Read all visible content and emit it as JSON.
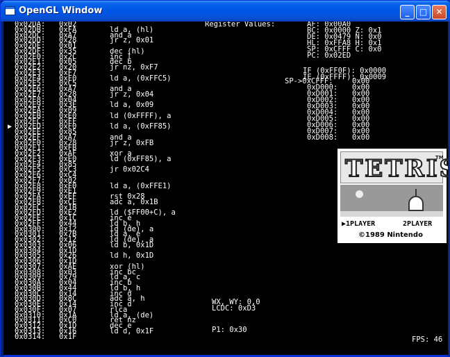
{
  "window": {
    "title": "OpenGL Window",
    "min": "_",
    "max": "□",
    "close": "✕"
  },
  "disasm": [
    {
      "addr": "0x02DA:",
      "byte": "0x02",
      "instr": ""
    },
    {
      "addr": "0x02DB:",
      "byte": "0xFA",
      "instr": "ld a, (hl)"
    },
    {
      "addr": "0x02DC:",
      "byte": "0xA7",
      "instr": "and a"
    },
    {
      "addr": "0x02DD:",
      "byte": "0x28",
      "instr": "jr z, 0x01"
    },
    {
      "addr": "0x02DE:",
      "byte": "0x01",
      "instr": ""
    },
    {
      "addr": "0x02DF:",
      "byte": "0x35",
      "instr": "dec (hl)"
    },
    {
      "addr": "0x02E0:",
      "byte": "0x2C",
      "instr": "inc l"
    },
    {
      "addr": "0x02E1:",
      "byte": "0x05",
      "instr": "dec b"
    },
    {
      "addr": "0x02E2:",
      "byte": "0x20",
      "instr": "jr nz, 0xF7"
    },
    {
      "addr": "0x02E3:",
      "byte": "0xF7",
      "instr": ""
    },
    {
      "addr": "0x02E4:",
      "byte": "0xF0",
      "instr": "ld a, (0xFFC5)"
    },
    {
      "addr": "0x02E5:",
      "byte": "0xC5",
      "instr": ""
    },
    {
      "addr": "0x02E6:",
      "byte": "0xA7",
      "instr": "and a"
    },
    {
      "addr": "0x02E7:",
      "byte": "0x28",
      "instr": "jr z, 0x04"
    },
    {
      "addr": "0x02E8:",
      "byte": "0x04",
      "instr": ""
    },
    {
      "addr": "0x02E9:",
      "byte": "0x3E",
      "instr": "ld a, 0x09"
    },
    {
      "addr": "0x02EA:",
      "byte": "0x09",
      "instr": ""
    },
    {
      "addr": "0x02EB:",
      "byte": "0xE0",
      "instr": "ld (0xFFFF), a"
    },
    {
      "addr": "0x02EC:",
      "byte": "0xFF",
      "instr": ""
    },
    {
      "addr": "0x02ED:",
      "byte": "0xF0",
      "instr": "ld a, (0xFF85)"
    },
    {
      "addr": "0x02EE:",
      "byte": "0x85",
      "instr": ""
    },
    {
      "addr": "0x02EF:",
      "byte": "0xA7",
      "instr": "and a"
    },
    {
      "addr": "0x02F0:",
      "byte": "0x28",
      "instr": "jr z, 0xFB"
    },
    {
      "addr": "0x02F1:",
      "byte": "0xFB",
      "instr": ""
    },
    {
      "addr": "0x02F2:",
      "byte": "0xAF",
      "instr": "xor a"
    },
    {
      "addr": "0x02F3:",
      "byte": "0xE0",
      "instr": "ld (0xFF85), a"
    },
    {
      "addr": "0x02F4:",
      "byte": "0x85",
      "instr": ""
    },
    {
      "addr": "0x02F5:",
      "byte": "0xC3",
      "instr": "jr 0x02C4"
    },
    {
      "addr": "0x02F6:",
      "byte": "0xC4",
      "instr": ""
    },
    {
      "addr": "0x02F7:",
      "byte": "0x02",
      "instr": ""
    },
    {
      "addr": "0x02F8:",
      "byte": "0xF0",
      "instr": "ld a, (0xFFE1)"
    },
    {
      "addr": "0x02F9:",
      "byte": "0xE1",
      "instr": ""
    },
    {
      "addr": "0x02FA:",
      "byte": "0xEF",
      "instr": "rst 0x28"
    },
    {
      "addr": "0x02FB:",
      "byte": "0xCE",
      "instr": "adc a, 0x1B"
    },
    {
      "addr": "0x02FC:",
      "byte": "0x1B",
      "instr": ""
    },
    {
      "addr": "0x02FD:",
      "byte": "0xE2",
      "instr": "ld ($FF00+C), a"
    },
    {
      "addr": "0x02FE:",
      "byte": "0x1C",
      "instr": "inc e"
    },
    {
      "addr": "0x02FF:",
      "byte": "0x44",
      "instr": "ld b, h"
    },
    {
      "addr": "0x0300:",
      "byte": "0x12",
      "instr": "ld (de), a"
    },
    {
      "addr": "0x0301:",
      "byte": "0x7B",
      "instr": "ld a, e"
    },
    {
      "addr": "0x0302:",
      "byte": "0x12",
      "instr": "ld (de), a"
    },
    {
      "addr": "0x0303:",
      "byte": "0x06",
      "instr": "ld b, 0x1D"
    },
    {
      "addr": "0x0304:",
      "byte": "0x1D",
      "instr": ""
    },
    {
      "addr": "0x0305:",
      "byte": "0x26",
      "instr": "ld h, 0x1D"
    },
    {
      "addr": "0x0306:",
      "byte": "0x1D",
      "instr": ""
    },
    {
      "addr": "0x0307:",
      "byte": "0xAE",
      "instr": "xor (hl)"
    },
    {
      "addr": "0x0308:",
      "byte": "0x03",
      "instr": "inc bc"
    },
    {
      "addr": "0x0309:",
      "byte": "0x79",
      "instr": "ld a, c"
    },
    {
      "addr": "0x030A:",
      "byte": "0x04",
      "instr": "inc b"
    },
    {
      "addr": "0x030B:",
      "byte": "0x44",
      "instr": "ld b, h"
    },
    {
      "addr": "0x030C:",
      "byte": "0x14",
      "instr": "inc d"
    },
    {
      "addr": "0x030D:",
      "byte": "0x8C",
      "instr": "adc a, h"
    },
    {
      "addr": "0x030E:",
      "byte": "0x14",
      "instr": "inc d"
    },
    {
      "addr": "0x030F:",
      "byte": "0x07",
      "instr": "rlca"
    },
    {
      "addr": "0x0310:",
      "byte": "0x1A",
      "instr": "ld a, (de)"
    },
    {
      "addr": "0x0311:",
      "byte": "0xC0",
      "instr": "ret nz"
    },
    {
      "addr": "0x0312:",
      "byte": "0x1D",
      "instr": "dec e"
    },
    {
      "addr": "0x0313:",
      "byte": "0x16",
      "instr": "ld d, 0x1F"
    },
    {
      "addr": "0x0314:",
      "byte": "0x1F",
      "instr": ""
    }
  ],
  "pc_marker": "▶",
  "registers": {
    "title": "Register Values:",
    "af": "AF: 0x00A0",
    "bc": "BC: 0x0000 Z: 0x1",
    "de": "DE: 0x0479 N: 0x0",
    "hl": "HL: 0xFFA8 H: 0x1",
    "sp": "SP: 0xCFFF C: 0x0",
    "pc": "PC: 0x02ED",
    "if": "IF (0xFF0F): 0x0000",
    "ie": "IE (0xFFFF): 0x0009"
  },
  "stack": [
    {
      "addr": "SP->0xCFFF:",
      "val": "0x00"
    },
    {
      "addr": "0xD000:",
      "val": "0x00"
    },
    {
      "addr": "0xD001:",
      "val": "0x00"
    },
    {
      "addr": "0xD002:",
      "val": "0x00"
    },
    {
      "addr": "0xD003:",
      "val": "0x00"
    },
    {
      "addr": "0xD004:",
      "val": "0x00"
    },
    {
      "addr": "0xD005:",
      "val": "0x00"
    },
    {
      "addr": "0xD006:",
      "val": "0x00"
    },
    {
      "addr": "0xD007:",
      "val": "0x00"
    },
    {
      "addr": "0xD008:",
      "val": "0x00"
    }
  ],
  "lcd": {
    "wx_wy": "WX, WY: 0,0",
    "lcdc": "LCDC: 0xD3",
    "p1": "P1: 0x30"
  },
  "game": {
    "logo": "TETRIS",
    "tm": "TM",
    "player1": "▶1PLAYER",
    "player2": "2PLAYER",
    "copyright": "©1989 Nintendo"
  },
  "fps": "FPS: 46"
}
